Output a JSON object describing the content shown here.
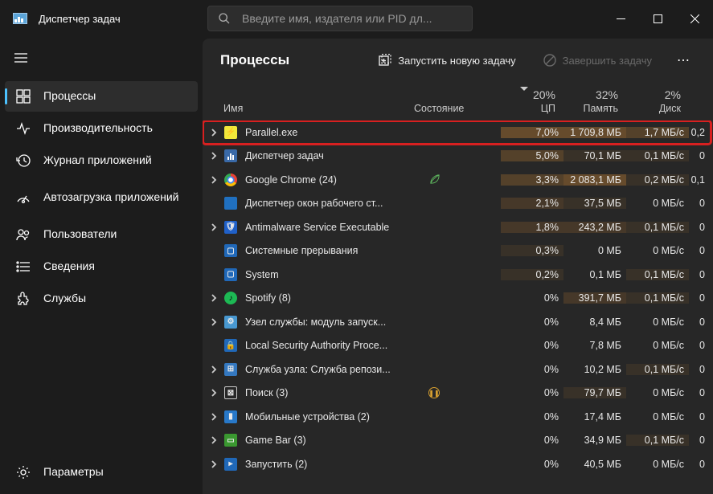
{
  "app": {
    "title": "Диспетчер задач"
  },
  "search": {
    "placeholder": "Введите имя, издателя или PID дл..."
  },
  "sidebar": {
    "items": [
      {
        "label": "Процессы"
      },
      {
        "label": "Производительность"
      },
      {
        "label": "Журнал приложений"
      },
      {
        "label": "Автозагрузка приложений"
      },
      {
        "label": "Пользователи"
      },
      {
        "label": "Сведения"
      },
      {
        "label": "Службы"
      }
    ],
    "settings": "Параметры"
  },
  "main": {
    "title": "Процессы",
    "run_task": "Запустить новую задачу",
    "end_task": "Завершить задачу"
  },
  "columns": {
    "name": "Имя",
    "status": "Состояние",
    "cpu": {
      "pct": "20%",
      "label": "ЦП"
    },
    "memory": {
      "pct": "32%",
      "label": "Память"
    },
    "disk": {
      "pct": "2%",
      "label": "Диск"
    }
  },
  "rows": [
    {
      "exp": true,
      "icon": "parallel",
      "name": "Parallel.exe",
      "cpu": "7,0%",
      "mem": "1 709,8 МБ",
      "disk": "1,7 МБ/с",
      "extra": "0,2",
      "highlight": true,
      "cpuHeat": 4,
      "memHeat": 4,
      "diskHeat": 3
    },
    {
      "exp": true,
      "icon": "tm",
      "name": "Диспетчер задач",
      "cpu": "5,0%",
      "mem": "70,1 МБ",
      "disk": "0,1 МБ/с",
      "extra": "0",
      "cpuHeat": 3,
      "memHeat": 1,
      "diskHeat": 1
    },
    {
      "exp": true,
      "icon": "chrome",
      "name": "Google Chrome (24)",
      "status": "leaf",
      "cpu": "3,3%",
      "mem": "2 083,1 МБ",
      "disk": "0,2 МБ/с",
      "extra": "0,1",
      "cpuHeat": 3,
      "memHeat": 4,
      "diskHeat": 1
    },
    {
      "exp": false,
      "icon": "win",
      "name": "Диспетчер окон рабочего ст...",
      "cpu": "2,1%",
      "mem": "37,5 МБ",
      "disk": "0 МБ/с",
      "extra": "0",
      "cpuHeat": 2,
      "memHeat": 1
    },
    {
      "exp": true,
      "icon": "shield",
      "name": "Antimalware Service Executable",
      "cpu": "1,8%",
      "mem": "243,2 МБ",
      "disk": "0,1 МБ/с",
      "extra": "0",
      "cpuHeat": 2,
      "memHeat": 2,
      "diskHeat": 1
    },
    {
      "exp": false,
      "icon": "sys",
      "name": "Системные прерывания",
      "cpu": "0,3%",
      "mem": "0 МБ",
      "disk": "0 МБ/с",
      "extra": "0",
      "cpuHeat": 1
    },
    {
      "exp": false,
      "icon": "sys",
      "name": "System",
      "cpu": "0,2%",
      "mem": "0,1 МБ",
      "disk": "0,1 МБ/с",
      "extra": "0",
      "cpuHeat": 1,
      "diskHeat": 1
    },
    {
      "exp": true,
      "icon": "spotify",
      "name": "Spotify (8)",
      "cpu": "0%",
      "mem": "391,7 МБ",
      "disk": "0,1 МБ/с",
      "extra": "0",
      "memHeat": 2,
      "diskHeat": 1
    },
    {
      "exp": true,
      "icon": "cog",
      "name": "Узел службы: модуль запуск...",
      "cpu": "0%",
      "mem": "8,4 МБ",
      "disk": "0 МБ/с",
      "extra": "0"
    },
    {
      "exp": false,
      "icon": "lock",
      "name": "Local Security Authority Proce...",
      "cpu": "0%",
      "mem": "7,8 МБ",
      "disk": "0 МБ/с",
      "extra": "0"
    },
    {
      "exp": true,
      "icon": "store",
      "name": "Служба узла: Служба репози...",
      "cpu": "0%",
      "mem": "10,2 МБ",
      "disk": "0,1 МБ/с",
      "extra": "0",
      "diskHeat": 1
    },
    {
      "exp": true,
      "icon": "search",
      "name": "Поиск (3)",
      "status": "pause",
      "cpu": "0%",
      "mem": "79,7 МБ",
      "disk": "0 МБ/с",
      "extra": "0",
      "memHeat": 1
    },
    {
      "exp": true,
      "icon": "mobile",
      "name": "Мобильные устройства (2)",
      "cpu": "0%",
      "mem": "17,4 МБ",
      "disk": "0 МБ/с",
      "extra": "0"
    },
    {
      "exp": true,
      "icon": "gamebar",
      "name": "Game Bar (3)",
      "cpu": "0%",
      "mem": "34,9 МБ",
      "disk": "0,1 МБ/с",
      "extra": "0",
      "diskHeat": 1
    },
    {
      "exp": true,
      "icon": "run",
      "name": "Запустить (2)",
      "cpu": "0%",
      "mem": "40,5 МБ",
      "disk": "0 МБ/с",
      "extra": "0"
    }
  ]
}
